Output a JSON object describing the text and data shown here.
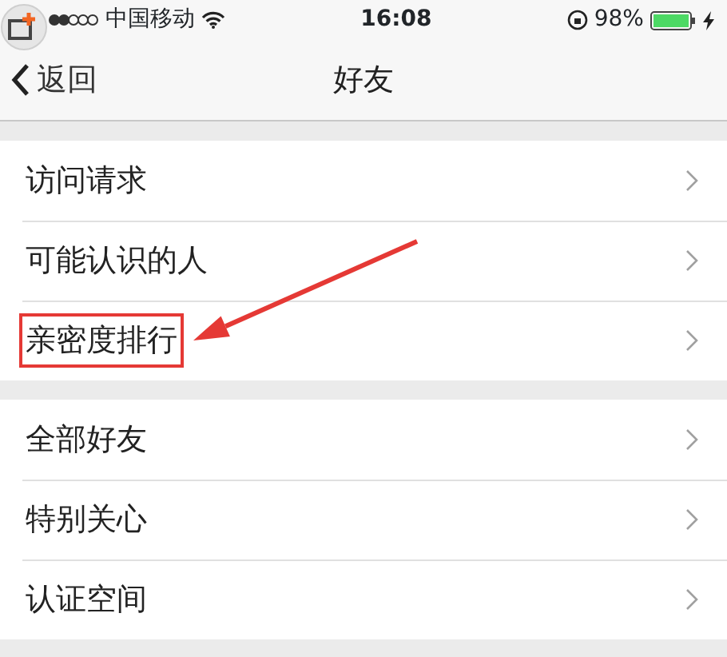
{
  "status_bar": {
    "carrier": "中国移动",
    "time": "16:08",
    "battery": "98%"
  },
  "nav_bar": {
    "back": "返回",
    "title": "好友"
  },
  "groups": [
    {
      "items": [
        {
          "label": "访问请求",
          "highlighted": false
        },
        {
          "label": "可能认识的人",
          "highlighted": false
        },
        {
          "label": "亲密度排行",
          "highlighted": true
        }
      ]
    },
    {
      "items": [
        {
          "label": "全部好友",
          "highlighted": false
        },
        {
          "label": "特别关心",
          "highlighted": false
        },
        {
          "label": "认证空间",
          "highlighted": false
        }
      ]
    }
  ]
}
